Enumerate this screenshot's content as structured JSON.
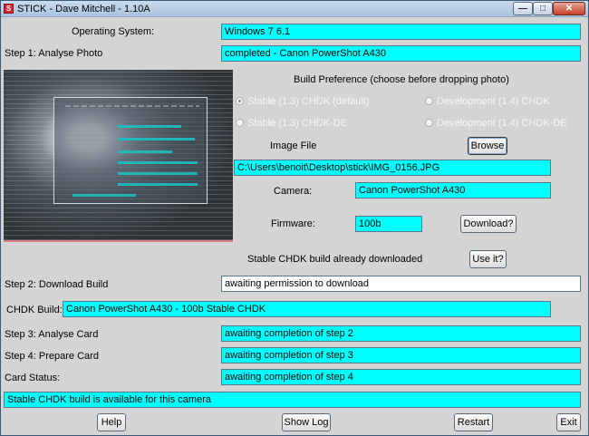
{
  "window": {
    "title": "STICK - Dave Mitchell - 1.10A",
    "app_icon_glyph": "S",
    "controls": {
      "minimize": "—",
      "maximize": "□",
      "close": "✕"
    }
  },
  "colors": {
    "field_cyan": "#00ffff",
    "field_white": "#ffffff",
    "window_bg": "#d4d4d4"
  },
  "os": {
    "label": "Operating System:",
    "value": "Windows 7 6.1"
  },
  "step1": {
    "label": "Step 1: Analyse Photo",
    "value": "completed - Canon PowerShot A430"
  },
  "build_preference": {
    "heading": "Build Preference (choose before dropping photo)",
    "options": [
      {
        "label": "Stable (1.3) CHDK (default)",
        "selected": true
      },
      {
        "label": "Development (1.4) CHDK",
        "selected": false
      },
      {
        "label": "Stable (1.3) CHDK-DE",
        "selected": false
      },
      {
        "label": "Development (1.4) CHDK-DE",
        "selected": false
      }
    ]
  },
  "image_file": {
    "label": "Image File",
    "browse_label": "Browse",
    "value": "C:\\Users\\benoit\\Desktop\\stick\\IMG_0156.JPG"
  },
  "camera": {
    "label": "Camera:",
    "value": "Canon PowerShot A430"
  },
  "firmware": {
    "label": "Firmware:",
    "value": "100b",
    "download_label": "Download?"
  },
  "downloaded": {
    "label": "Stable CHDK build already downloaded",
    "use_label": "Use it?"
  },
  "step2": {
    "label": "Step 2: Download Build",
    "value": "awaiting permission to download"
  },
  "chdk_build": {
    "label": "CHDK Build:",
    "value": "Canon PowerShot A430 - 100b Stable CHDK"
  },
  "step3": {
    "label": "Step 3: Analyse Card",
    "value": "awaiting completion of step 2"
  },
  "step4": {
    "label": "Step 4: Prepare Card",
    "value": "awaiting completion of step 3"
  },
  "card_status": {
    "label": "Card Status:",
    "value": "awaiting completion of step 4"
  },
  "status_bar": {
    "value": "Stable CHDK build is available for this camera"
  },
  "footer": {
    "help": "Help",
    "show_log": "Show Log",
    "restart": "Restart",
    "exit": "Exit"
  }
}
